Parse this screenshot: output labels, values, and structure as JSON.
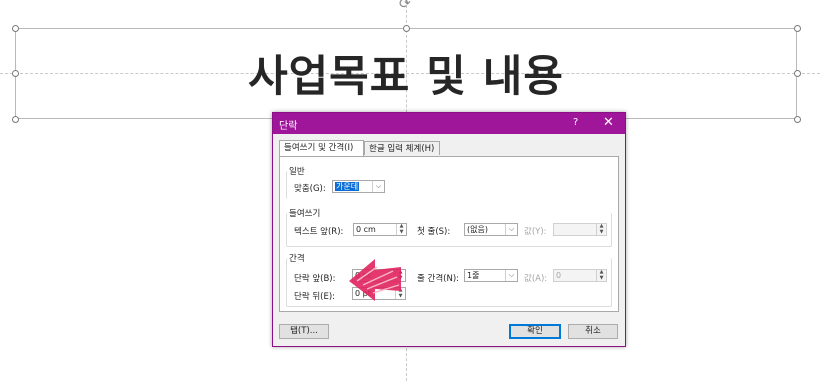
{
  "slide": {
    "title": "사업목표 및 내용"
  },
  "dialog": {
    "title": "단락",
    "help_label": "?",
    "close_label": "✕",
    "tabs": [
      {
        "label": "들여쓰기 및 간격(I)"
      },
      {
        "label": "한글 입력 체계(H)"
      }
    ],
    "general": {
      "section_label": "일반",
      "alignment_label": "맞춤(G):",
      "alignment_value": "가운데"
    },
    "indent": {
      "section_label": "들여쓰기",
      "before_text_label": "텍스트 앞(R):",
      "before_text_value": "0 cm",
      "special_label": "첫 줄(S):",
      "special_value": "(없음)",
      "by_label": "값(Y):",
      "by_value": ""
    },
    "spacing": {
      "section_label": "간격",
      "before_label": "단락 앞(B):",
      "before_value": "0 pt",
      "after_label": "단락 뒤(E):",
      "after_value": "0 pt",
      "line_spacing_label": "줄 간격(N):",
      "line_spacing_value": "1줄",
      "at_label": "값(A):",
      "at_value": "0"
    },
    "buttons": {
      "tabs_label": "탭(T)...",
      "ok_label": "확인",
      "cancel_label": "취소"
    }
  },
  "colors": {
    "titlebar": "#a0169b",
    "accent_arrow": "#e0245e"
  }
}
